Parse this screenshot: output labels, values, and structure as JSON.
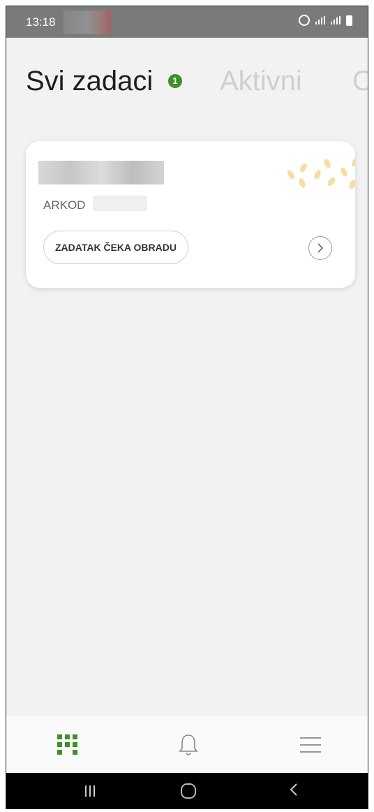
{
  "status_bar": {
    "time": "13:18"
  },
  "tabs": [
    {
      "label": "Svi zadaci",
      "badge": "1",
      "selected": true
    },
    {
      "label": "Aktivni",
      "selected": false
    },
    {
      "label": "O",
      "selected": false
    }
  ],
  "task_card": {
    "arkod_label": "ARKOD",
    "status_label": "ZADATAK ČEKA OBRADU",
    "open_icon": "chevron-right-icon"
  },
  "bottom_nav": [
    {
      "icon": "grid-icon",
      "selected": true
    },
    {
      "icon": "bell-icon",
      "selected": false
    },
    {
      "icon": "menu-icon",
      "selected": false
    }
  ],
  "colors": {
    "accent": "#3f8f2a",
    "inactive_tab": "#cfcfcf"
  }
}
